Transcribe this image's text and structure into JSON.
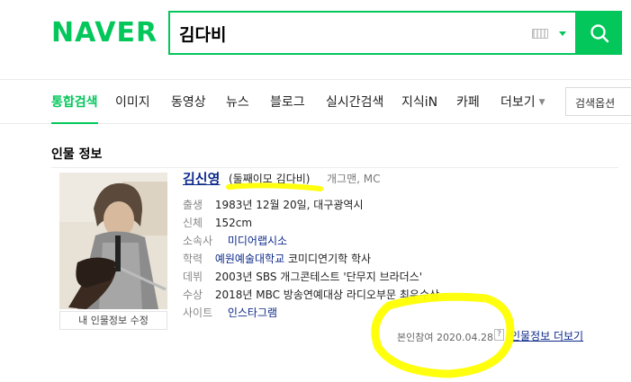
{
  "brand": {
    "logo": "NAVER",
    "accent": "#03c75a"
  },
  "search": {
    "query": "김다비",
    "placeholder": ""
  },
  "tabs": [
    {
      "label": "통합검색",
      "active": true
    },
    {
      "label": "이미지"
    },
    {
      "label": "동영상"
    },
    {
      "label": "뉴스"
    },
    {
      "label": "블로그"
    },
    {
      "label": "실시간검색"
    },
    {
      "label": "지식iN"
    },
    {
      "label": "카페"
    },
    {
      "label": "더보기"
    }
  ],
  "options_button": "검색옵션",
  "section": {
    "title": "인물 정보"
  },
  "person": {
    "name": "김신영",
    "alias": "(둘째이모 김다비)",
    "job": "개그맨, MC",
    "edit_button": "내 인물정보 수정",
    "rows": [
      {
        "label": "출생",
        "value": "1983년 12월 20일, 대구광역시"
      },
      {
        "label": "신체",
        "value": "152cm"
      },
      {
        "label": "소속사",
        "value": "미디어랩시소",
        "link": true
      },
      {
        "label": "학력",
        "link_text": "예원예술대학교",
        "value": "코미디연기학 학사"
      },
      {
        "label": "데뷔",
        "value": "2003년 SBS 개그콘테스트 '단무지 브라더스'"
      },
      {
        "label": "수상",
        "value": "2018년 MBC 방송연예대상 라디오부문 최우수상"
      },
      {
        "label": "사이트",
        "value": "인스타그램",
        "link": true
      }
    ],
    "participation": "본인참여 2020.04.28.",
    "help": "?",
    "more_link": "인물정보 더보기"
  }
}
